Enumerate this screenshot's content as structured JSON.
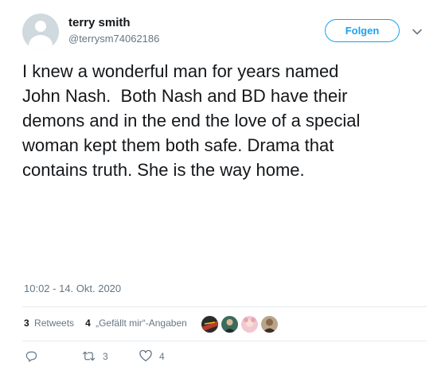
{
  "user": {
    "display_name": "terry smith",
    "handle": "@terrysm74062186"
  },
  "follow_button": {
    "label": "Folgen"
  },
  "tweet": {
    "text": "I knew a wonderful man for years named\nJohn Nash.  Both Nash and BD have their\ndemons and in the end the love of a special\nwoman kept them both safe. Drama that\ncontains truth. She is the way home.",
    "timestamp": "10:02 - 14. Okt. 2020"
  },
  "stats": {
    "retweets_count": "3",
    "retweets_label": "Retweets",
    "likes_count": "4",
    "likes_label": "„Gefällt mir“-Angaben"
  },
  "likers": [
    {
      "icon": "liker-avatar-1",
      "color": "#c0392b"
    },
    {
      "icon": "liker-avatar-2",
      "color": "#3d6b5b"
    },
    {
      "icon": "liker-avatar-3",
      "color": "#e8a3b5"
    },
    {
      "icon": "liker-avatar-4",
      "color": "#8a6a4e"
    }
  ],
  "actions": {
    "reply_count": "",
    "retweet_count": "3",
    "like_count": "4"
  },
  "colors": {
    "accent": "#1da1f2",
    "text": "#14171a",
    "secondary": "#657786"
  }
}
